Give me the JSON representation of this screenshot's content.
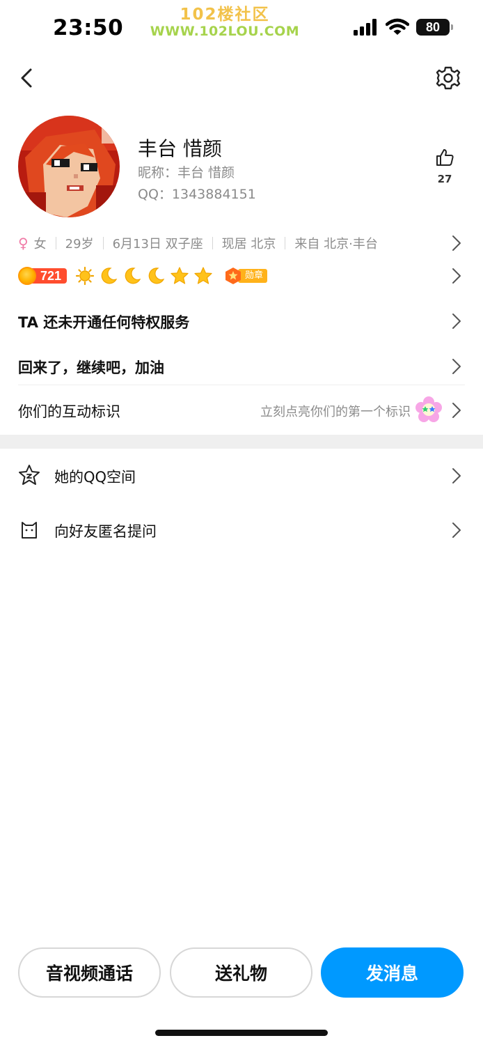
{
  "status_bar": {
    "time": "23:50",
    "battery": "80",
    "watermark_title": "102楼社区",
    "watermark_url": "WWW.102LOU.COM",
    "icons": [
      "signal-icon",
      "wifi-icon",
      "battery-icon"
    ]
  },
  "nav": {
    "back_icon": "chevron-left-icon",
    "settings_icon": "gear-icon"
  },
  "profile": {
    "name": "丰台  惜颜",
    "nickname": "昵称：丰台  惜颜",
    "qq": "QQ：1343884151",
    "like_count": "27"
  },
  "info": {
    "gender_symbol": "♀",
    "gender": "女",
    "age": "29岁",
    "birthday": "6月13日 双子座",
    "current_city": "现居 北京",
    "hometown": "来自 北京·丰台"
  },
  "level": {
    "value": "721",
    "icons": [
      "sun-icon",
      "moon-icon",
      "moon-icon",
      "moon-icon",
      "star-icon",
      "star-icon"
    ],
    "medal_label": "勋章"
  },
  "rows": {
    "privilege": "TA 还未开通任何特权服务",
    "signature": "回来了，继续吧，加油",
    "interaction_label": "你们的互动标识",
    "interaction_hint": "立刻点亮你们的第一个标识"
  },
  "menu": [
    {
      "label": "她的QQ空间",
      "icon": "star-face-icon"
    },
    {
      "label": "向好友匿名提问",
      "icon": "cat-chat-icon"
    }
  ],
  "actions": {
    "call": "音视频通话",
    "gift": "送礼物",
    "message": "发消息"
  },
  "colors": {
    "primary": "#0099ff",
    "level_badge": "#ff4d2e",
    "medal": "#ffb21a",
    "muted_text": "#8c8c8c"
  }
}
